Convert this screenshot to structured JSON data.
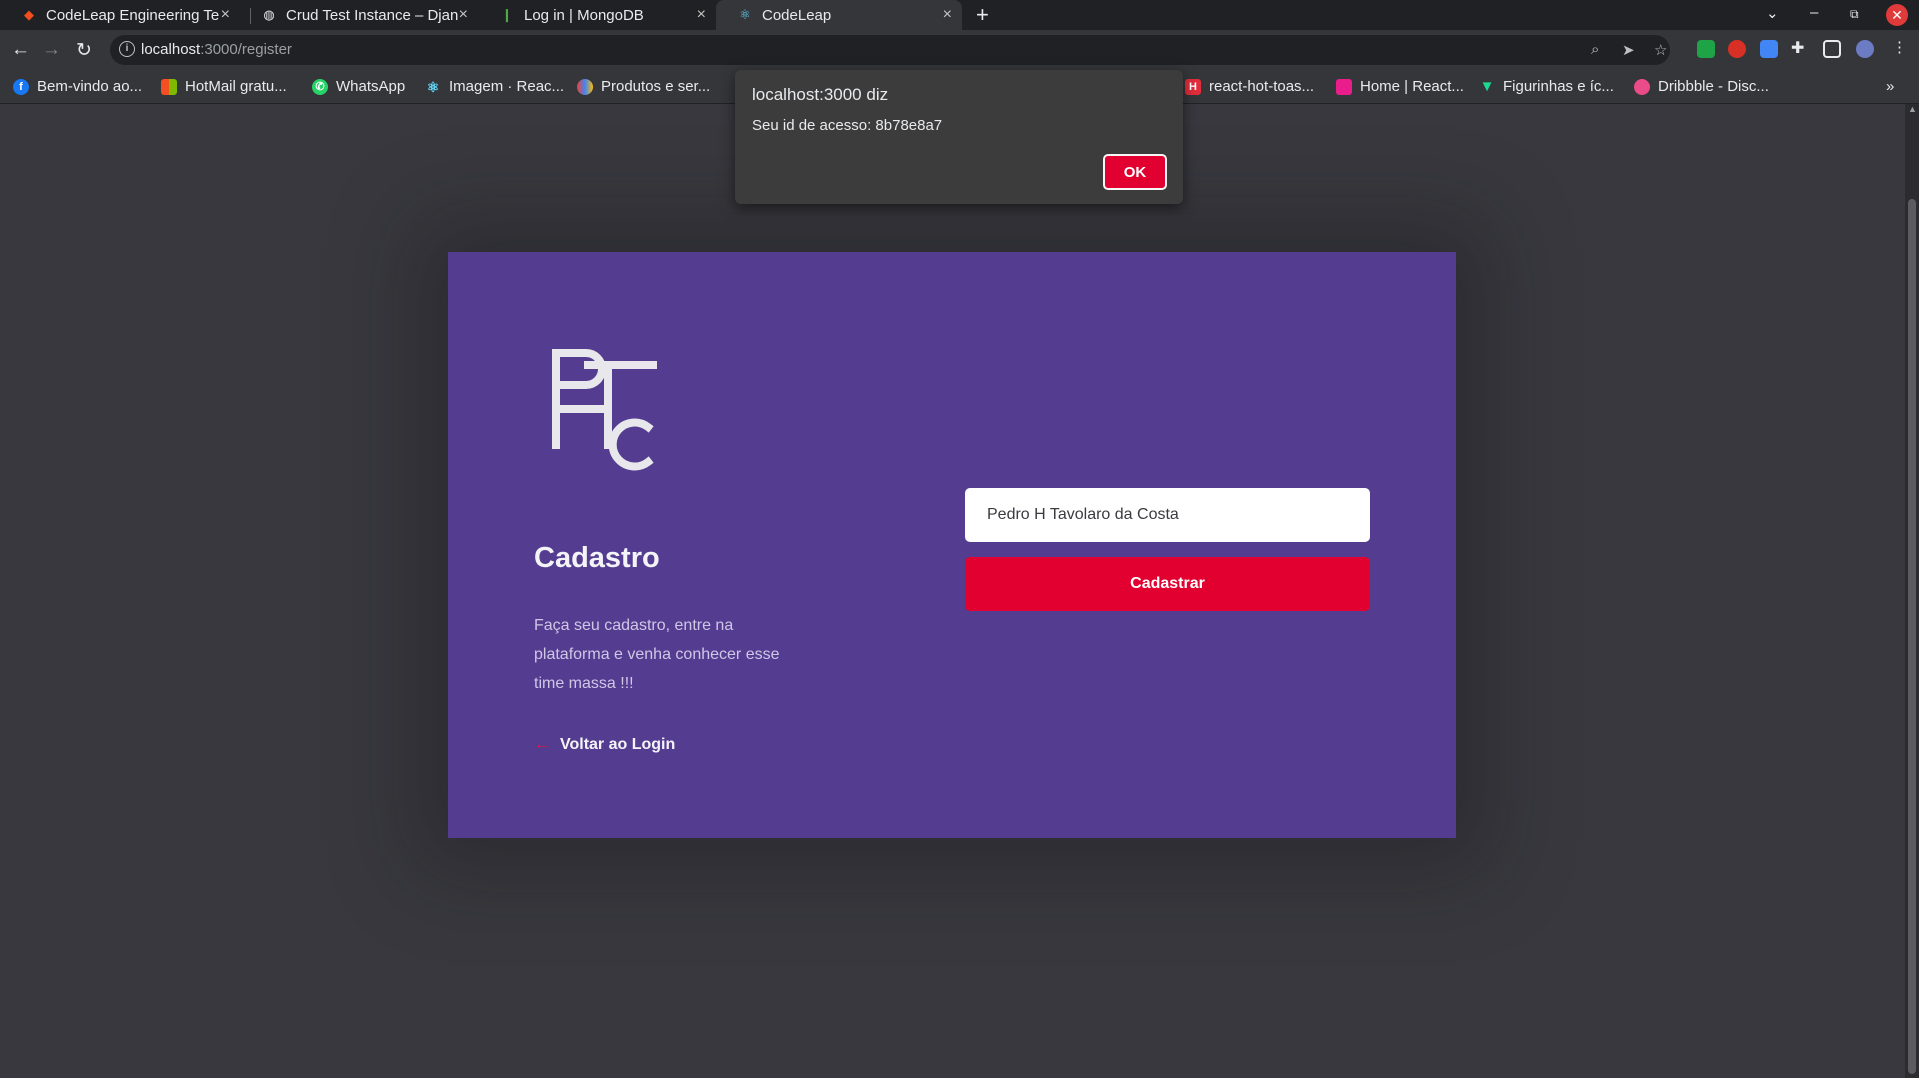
{
  "browser": {
    "tabs": [
      {
        "title": "CodeLeap Engineering Te",
        "icon": "figma-icon"
      },
      {
        "title": "Crud Test Instance – Djan",
        "icon": "globe-icon"
      },
      {
        "title": "Log in | MongoDB",
        "icon": "mongodb-icon"
      },
      {
        "title": "CodeLeap",
        "icon": "react-icon",
        "active": true
      }
    ],
    "url_host": "localhost",
    "url_rest": ":3000/register",
    "bookmarks": [
      {
        "label": "Bem-vindo ao...",
        "icon": "facebook-icon",
        "color": "#1877f2"
      },
      {
        "label": "HotMail gratu...",
        "icon": "microsoft-icon",
        "color": "#f25022"
      },
      {
        "label": "WhatsApp",
        "icon": "whatsapp-icon",
        "color": "#25d366"
      },
      {
        "label": "Imagem · Reac...",
        "icon": "react-icon",
        "color": "#61dafb"
      },
      {
        "label": "Produtos e ser...",
        "icon": "google-cloud-icon",
        "color": "#ea4335"
      },
      {
        "label": "react-hot-toas...",
        "icon": "hot-toast-icon",
        "color": "#e22d3c"
      },
      {
        "label": "Home | React...",
        "icon": "pink-square-icon",
        "color": "#e91e8c"
      },
      {
        "label": "Figurinhas e íc...",
        "icon": "vuetify-icon",
        "color": "#1dd98f"
      },
      {
        "label": "Dribbble - Disc...",
        "icon": "dribbble-icon",
        "color": "#ea4c89"
      }
    ]
  },
  "dialog": {
    "title": "localhost:3000 diz",
    "message": "Seu id de acesso: 8b78e8a7",
    "ok_label": "OK"
  },
  "register": {
    "logo_text": "PHTC",
    "title": "Cadastro",
    "description": "Faça seu cadastro, entre na plataforma e venha conhecer esse time massa !!!",
    "back_link": "Voltar ao Login",
    "name_value": "Pedro H Tavolaro da Costa",
    "submit_label": "Cadastrar"
  },
  "colors": {
    "card_bg": "#543d91",
    "accent": "#e1002f",
    "page_bg": "#38383e"
  }
}
